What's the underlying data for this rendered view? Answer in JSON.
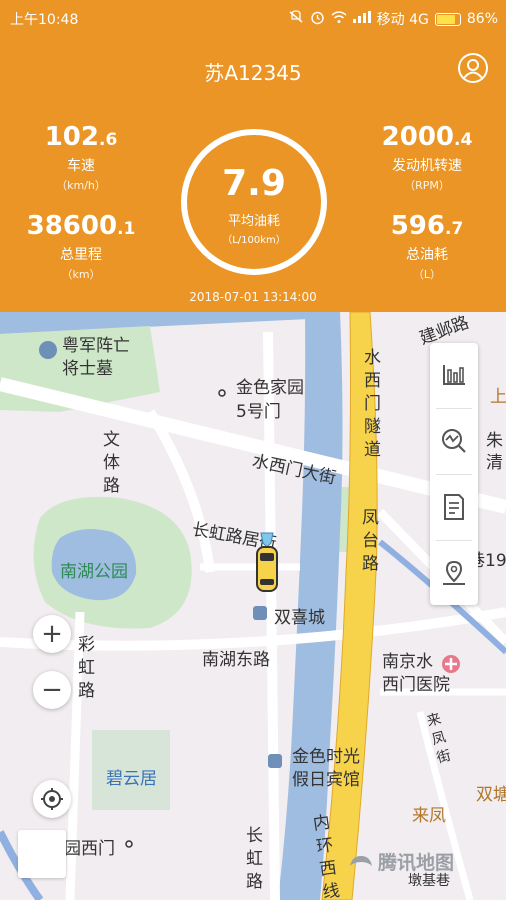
{
  "status_bar": {
    "time": "上午10:48",
    "carrier": "移动 4G",
    "battery_percent": "86%",
    "battery_level": 0.86,
    "icons": [
      "mute-icon",
      "alarm-icon",
      "wifi-icon",
      "signal-icon",
      "battery-icon"
    ]
  },
  "header": {
    "plate": "苏A12345",
    "profile_icon": "user-icon",
    "speed": {
      "value": "102",
      "decimal": ".6",
      "label": "车速",
      "unit": "（km/h）"
    },
    "mileage": {
      "value": "38600",
      "decimal": ".1",
      "label": "总里程",
      "unit": "（km）"
    },
    "rpm": {
      "value": "2000",
      "decimal": ".4",
      "label": "发动机转速",
      "unit": "（RPM）"
    },
    "fuel_total": {
      "value": "596",
      "decimal": ".7",
      "label": "总油耗",
      "unit": "（L）"
    },
    "avg_fuel": {
      "value": "7.9",
      "label": "平均油耗",
      "unit": "（L/100km）"
    },
    "datetime": "2018-07-01   13:14:00"
  },
  "map": {
    "labels": {
      "memorial_a": "粤军阵亡",
      "memorial_b": "将士墓",
      "jinse_a": "金色家园",
      "jinse_b": "5号门",
      "wenti_road": "文体路",
      "shuiximen_tunnel": "水西门隧道",
      "jianye_road": "建邺路",
      "zhu_qing": "朱清",
      "shuiximen_street": "水西门大街",
      "changhong_street": "长虹路居街",
      "fengtai_road": "凤台路",
      "nanhu_park": "南湖公园",
      "shuangxi_city": "双喜城",
      "caihong_road": "彩虹路",
      "nanhu_east_road": "南湖东路",
      "nanjing_hospital_a": "南京水",
      "nanjing_hospital_b": "西门医院",
      "laifeng_street": "来凤街",
      "biyun_ju": "碧云居",
      "hotel_a": "金色时光",
      "hotel_b": "假日宾馆",
      "inner_ring": "内环西线",
      "changhong_road": "长虹路",
      "yuan_ximen": "园西门",
      "laifeng": "来凤",
      "shuangtang": "双塘",
      "shangfang": "上",
      "jie19": "巷19",
      "bottom_street": "墩基巷"
    },
    "watermark": "腾讯地图",
    "zoom_in_label": "+",
    "zoom_out_label": "−"
  },
  "toolbar": {
    "buttons": [
      "bar-chart-icon",
      "trend-search-icon",
      "report-icon",
      "location-pin-icon"
    ]
  },
  "colors": {
    "brand": "#ea9525",
    "water": "#9fbde0",
    "green": "#cfe7c9",
    "highway": "#f6d34a"
  }
}
